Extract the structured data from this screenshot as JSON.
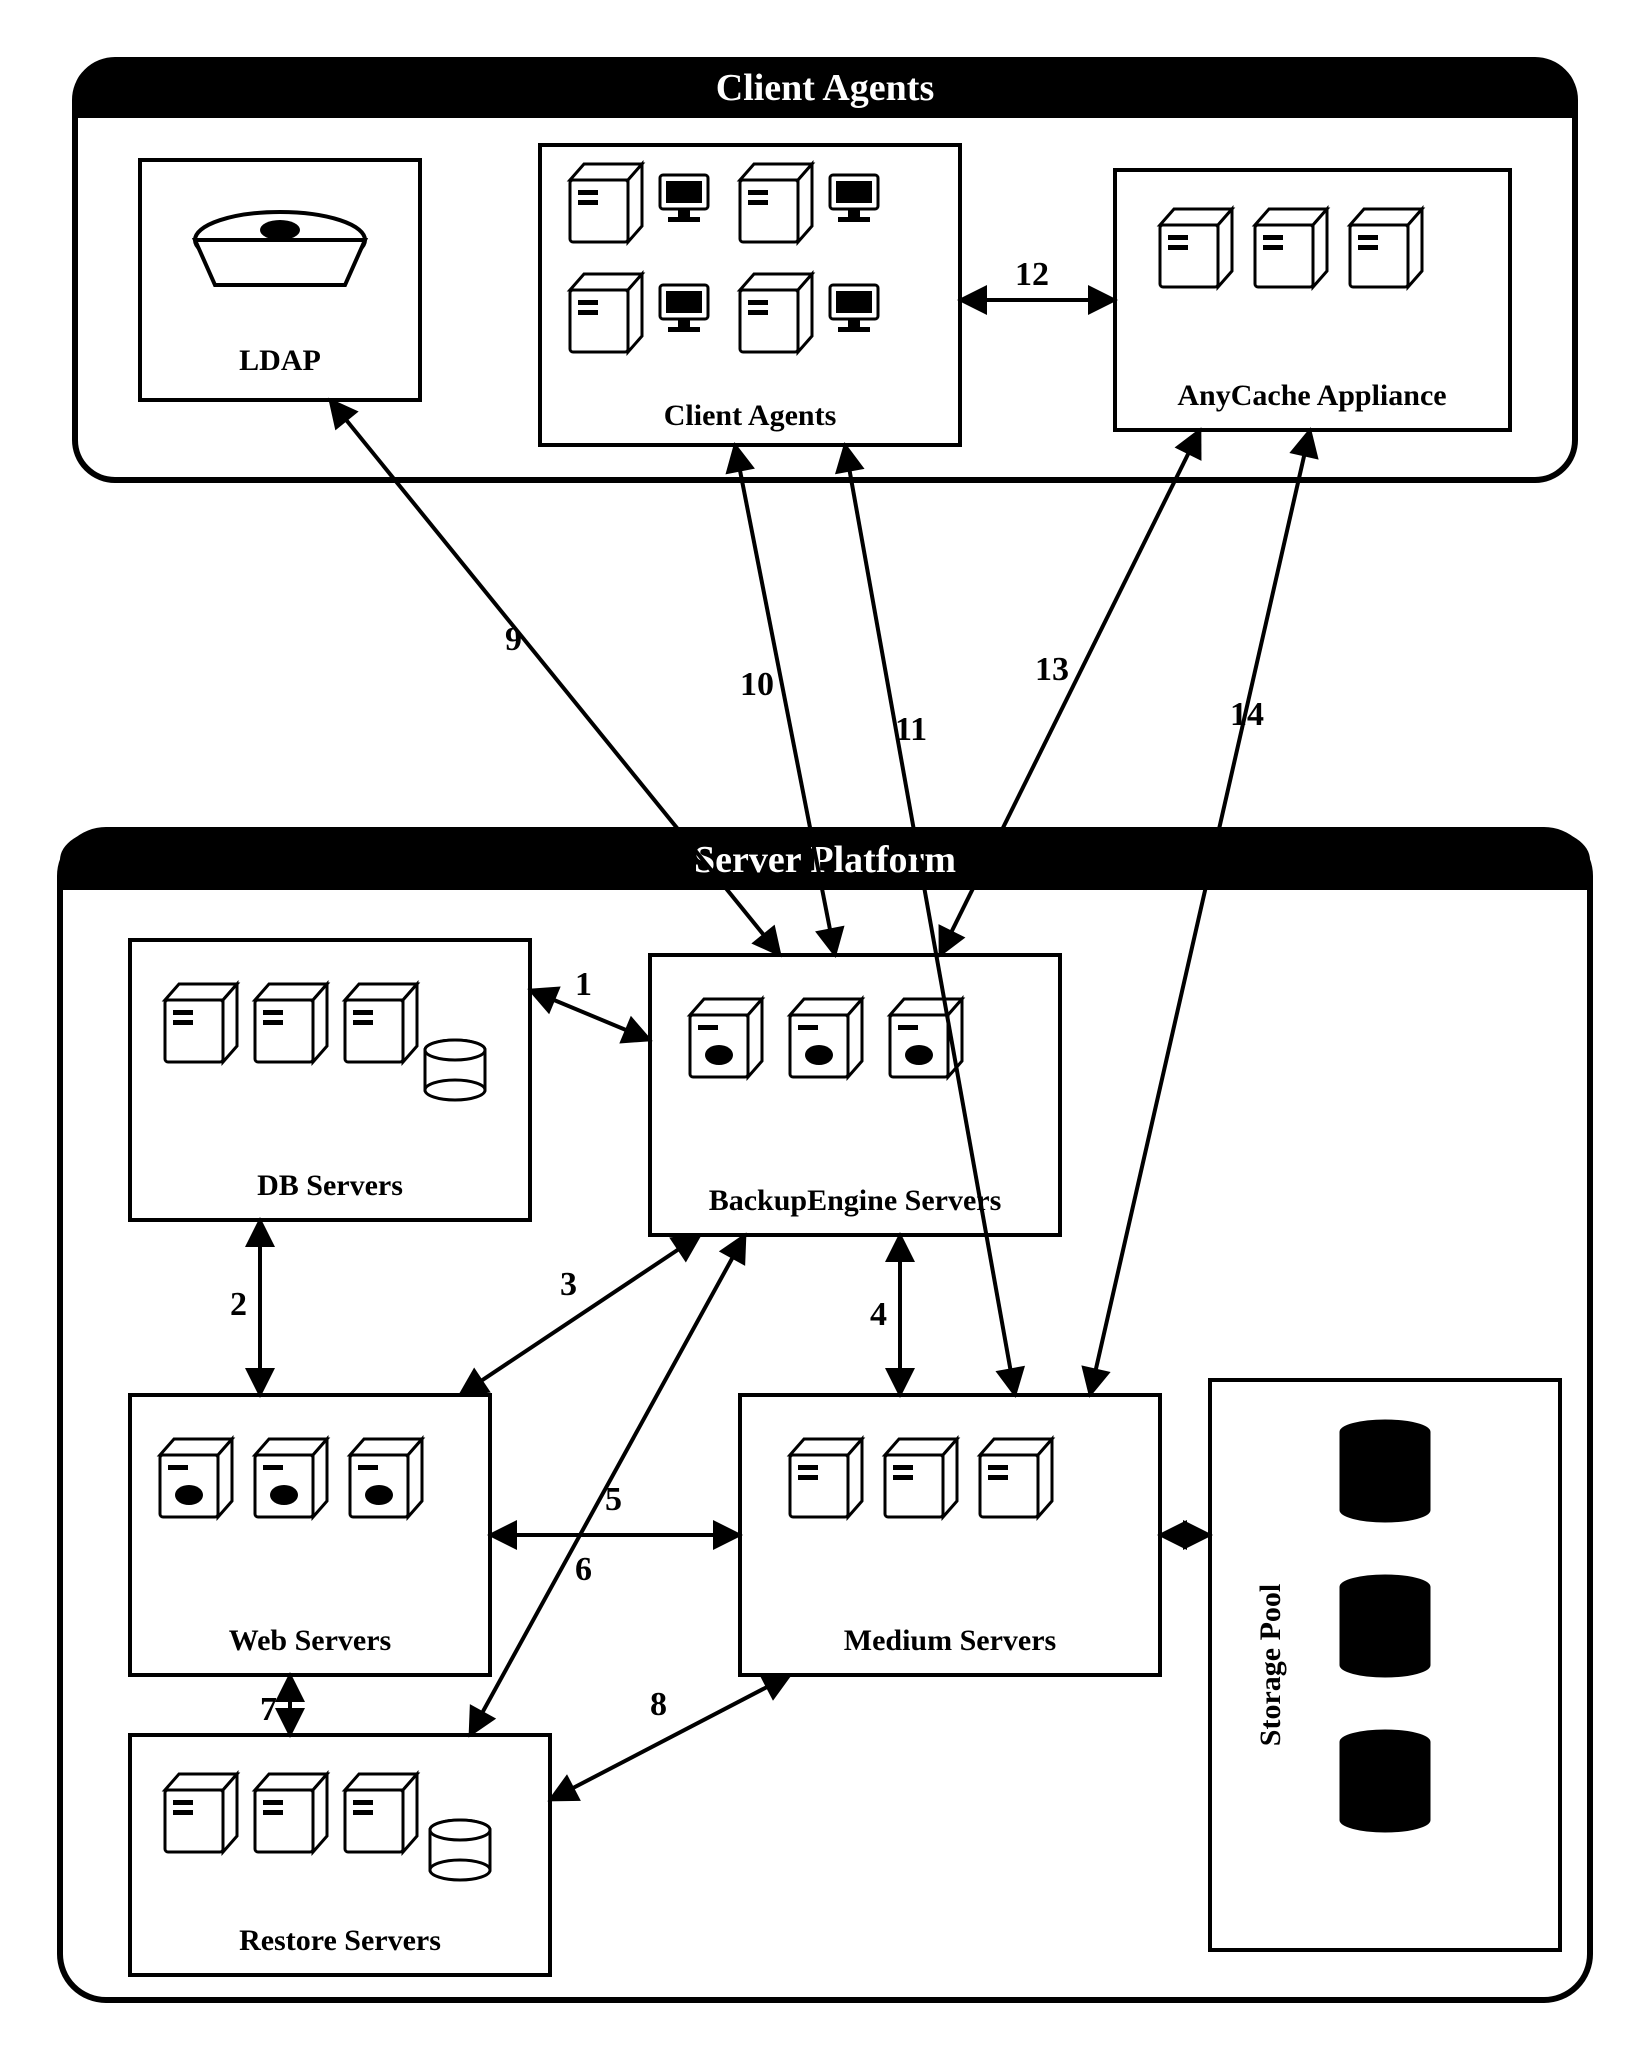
{
  "panels": {
    "client": {
      "title": "Client Agents"
    },
    "server": {
      "title": "Server Platform"
    }
  },
  "nodes": {
    "ldap": "LDAP",
    "clientAgents": "Client Agents",
    "anycache": "AnyCache Appliance",
    "dbServers": "DB Servers",
    "backupEngine": "BackupEngine Servers",
    "webServers": "Web Servers",
    "mediumServers": "Medium Servers",
    "restoreServers": "Restore Servers",
    "storagePool": "Storage Pool"
  },
  "edges": {
    "e1": "1",
    "e2": "2",
    "e3": "3",
    "e4": "4",
    "e5": "5",
    "e6": "6",
    "e7": "7",
    "e8": "8",
    "e9": "9",
    "e10": "10",
    "e11": "11",
    "e12": "12",
    "e13": "13",
    "e14": "14"
  },
  "chart_data": {
    "type": "diagram",
    "title": "",
    "groups": [
      {
        "id": "client",
        "label": "Client Agents",
        "nodes": [
          "ldap",
          "clientAgents",
          "anycache"
        ]
      },
      {
        "id": "server",
        "label": "Server Platform",
        "nodes": [
          "dbServers",
          "backupEngine",
          "webServers",
          "mediumServers",
          "restoreServers",
          "storagePool"
        ]
      }
    ],
    "nodes": [
      {
        "id": "ldap",
        "label": "LDAP"
      },
      {
        "id": "clientAgents",
        "label": "Client Agents"
      },
      {
        "id": "anycache",
        "label": "AnyCache Appliance"
      },
      {
        "id": "dbServers",
        "label": "DB Servers"
      },
      {
        "id": "backupEngine",
        "label": "BackupEngine Servers"
      },
      {
        "id": "webServers",
        "label": "Web Servers"
      },
      {
        "id": "mediumServers",
        "label": "Medium Servers"
      },
      {
        "id": "restoreServers",
        "label": "Restore Servers"
      },
      {
        "id": "storagePool",
        "label": "Storage Pool"
      }
    ],
    "edges": [
      {
        "id": 1,
        "from": "backupEngine",
        "to": "dbServers",
        "bidirectional": true
      },
      {
        "id": 2,
        "from": "webServers",
        "to": "dbServers",
        "bidirectional": true
      },
      {
        "id": 3,
        "from": "backupEngine",
        "to": "webServers",
        "bidirectional": true
      },
      {
        "id": 4,
        "from": "mediumServers",
        "to": "backupEngine",
        "bidirectional": true
      },
      {
        "id": 5,
        "from": "mediumServers",
        "to": "webServers",
        "bidirectional": true
      },
      {
        "id": 6,
        "from": "backupEngine",
        "to": "restoreServers",
        "bidirectional": true
      },
      {
        "id": 7,
        "from": "webServers",
        "to": "restoreServers",
        "bidirectional": true
      },
      {
        "id": 8,
        "from": "mediumServers",
        "to": "restoreServers",
        "bidirectional": true
      },
      {
        "id": 9,
        "from": "ldap",
        "to": "backupEngine",
        "bidirectional": true
      },
      {
        "id": 10,
        "from": "clientAgents",
        "to": "backupEngine",
        "bidirectional": true
      },
      {
        "id": 11,
        "from": "clientAgents",
        "to": "mediumServers",
        "bidirectional": true
      },
      {
        "id": 12,
        "from": "clientAgents",
        "to": "anycache",
        "bidirectional": true
      },
      {
        "id": 13,
        "from": "anycache",
        "to": "backupEngine",
        "bidirectional": true
      },
      {
        "id": 14,
        "from": "anycache",
        "to": "mediumServers",
        "bidirectional": true
      },
      {
        "id": null,
        "from": "mediumServers",
        "to": "storagePool",
        "bidirectional": true
      }
    ]
  }
}
